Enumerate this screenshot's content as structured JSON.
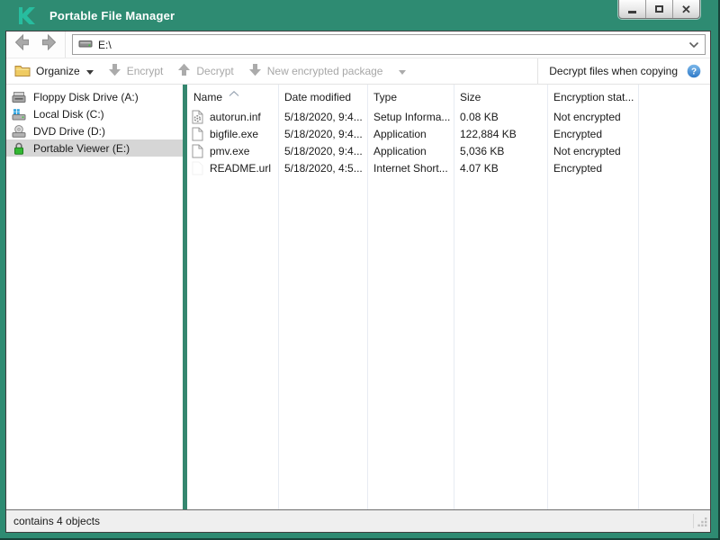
{
  "window": {
    "title": "Portable File Manager",
    "controls": [
      "minimize",
      "maximize",
      "close"
    ]
  },
  "navbar": {
    "back": "back",
    "forward": "forward",
    "address_value": "E:\\"
  },
  "toolbar": {
    "organize_label": "Organize",
    "encrypt_label": "Encrypt",
    "decrypt_label": "Decrypt",
    "new_package_label": "New encrypted package",
    "decrypt_copy_label": "Decrypt files when copying"
  },
  "sidebar": {
    "items": [
      {
        "label": "Floppy Disk Drive (A:)",
        "icon": "floppy-drive-icon",
        "selected": false
      },
      {
        "label": "Local Disk (C:)",
        "icon": "hard-disk-icon",
        "selected": false
      },
      {
        "label": "DVD Drive (D:)",
        "icon": "dvd-drive-icon",
        "selected": false
      },
      {
        "label": "Portable Viewer (E:)",
        "icon": "lock-icon",
        "selected": true
      }
    ]
  },
  "file_list": {
    "columns": [
      "Name",
      "Date modified",
      "Type",
      "Size",
      "Encryption stat..."
    ],
    "sort_column": "Name",
    "sort_direction": "asc",
    "rows": [
      {
        "icon": "setup-file-icon",
        "name": "autorun.inf",
        "date": "5/18/2020, 9:4...",
        "type": "Setup Informa...",
        "size": "0.08 KB",
        "encryption": "Not encrypted"
      },
      {
        "icon": "file-icon",
        "name": "bigfile.exe",
        "date": "5/18/2020, 9:4...",
        "type": "Application",
        "size": "122,884 KB",
        "encryption": "Encrypted"
      },
      {
        "icon": "file-icon",
        "name": "pmv.exe",
        "date": "5/18/2020, 9:4...",
        "type": "Application",
        "size": "5,036 KB",
        "encryption": "Not encrypted"
      },
      {
        "icon": "url-file-icon",
        "name": "README.url",
        "date": "5/18/2020, 4:5...",
        "type": "Internet Short...",
        "size": "4.07 KB",
        "encryption": "Encrypted"
      }
    ]
  },
  "statusbar": {
    "text": "contains 4 objects"
  },
  "colors": {
    "titlebar_teal": "#2E8B72",
    "logo_green": "#27BD9F",
    "divider_teal": "#35876F",
    "selection_gray": "#D6D6D6",
    "help_blue": "#2E79C7",
    "disabled_text": "#A7A7A7",
    "folder_yellow": "#EFCB62",
    "lock_green": "#33B733"
  }
}
